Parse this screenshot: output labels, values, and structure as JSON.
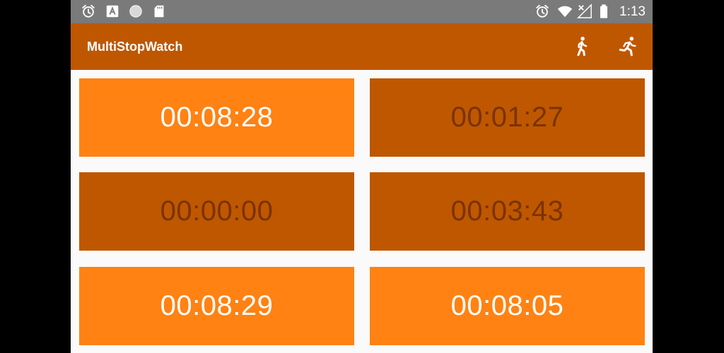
{
  "status_bar": {
    "time": "1:13",
    "left_icons": [
      "alarm-icon",
      "text-a-icon",
      "circle-icon",
      "sd-card-icon"
    ],
    "right_icons": [
      "alarm-icon",
      "wifi-icon",
      "signal-off-icon",
      "battery-icon"
    ]
  },
  "app_bar": {
    "title": "MultiStopWatch",
    "actions": [
      "walk-icon",
      "run-icon"
    ]
  },
  "stopwatches": [
    {
      "time": "00:08:28",
      "state": "running"
    },
    {
      "time": "00:01:27",
      "state": "stopped"
    },
    {
      "time": "00:00:00",
      "state": "stopped"
    },
    {
      "time": "00:03:43",
      "state": "stopped"
    },
    {
      "time": "00:08:29",
      "state": "running"
    },
    {
      "time": "00:08:05",
      "state": "running"
    }
  ],
  "colors": {
    "app_bar": "#bf5700",
    "running_tile": "#ff8213",
    "stopped_tile": "#bf5700",
    "running_text": "#ffffff",
    "stopped_text": "#7a3300",
    "status_bar": "#7a7a7a",
    "background": "#fafafa"
  }
}
